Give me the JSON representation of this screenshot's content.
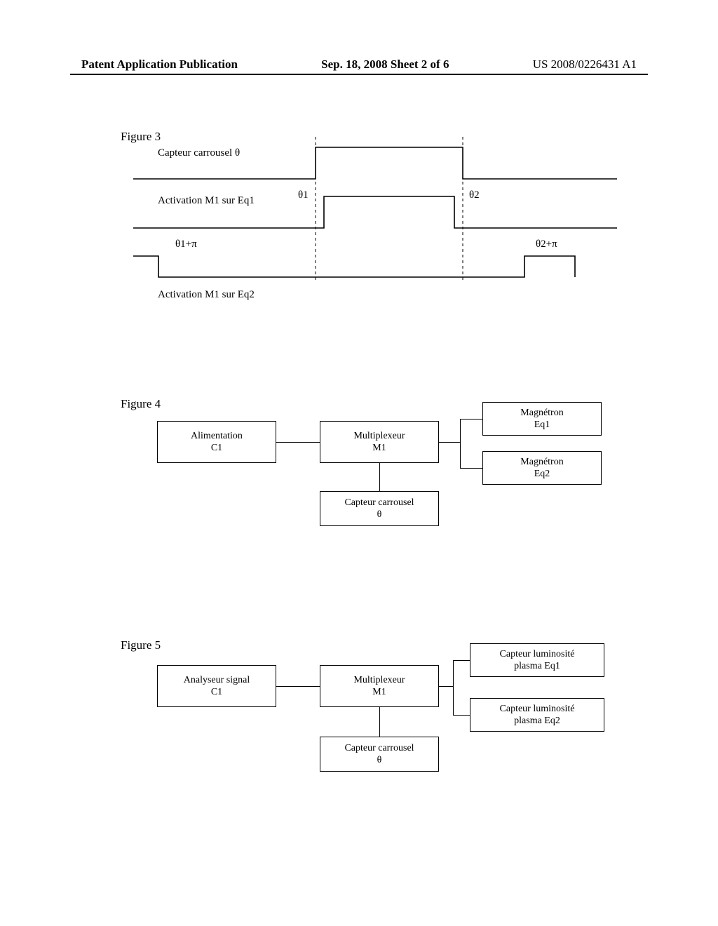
{
  "header": {
    "left": "Patent Application Publication",
    "center": "Sep. 18, 2008  Sheet 2 of 6",
    "right": "US 2008/0226431 A1"
  },
  "fig3": {
    "title": "Figure 3",
    "row1": "Capteur carrousel θ",
    "row2": "Activation M1 sur Eq1",
    "row3": "Activation M1 sur Eq2",
    "theta1": "θ1",
    "theta2": "θ2",
    "theta1pi": "θ1+π",
    "theta2pi": "θ2+π"
  },
  "fig4": {
    "title": "Figure 4",
    "c1_l1": "Alimentation",
    "c1_l2": "C1",
    "m1_l1": "Multiplexeur",
    "m1_l2": "M1",
    "eq1_l1": "Magnétron",
    "eq1_l2": "Eq1",
    "eq2_l1": "Magnétron",
    "eq2_l2": "Eq2",
    "th_l1": "Capteur carrousel",
    "th_l2": "θ"
  },
  "fig5": {
    "title": "Figure 5",
    "c1_l1": "Analyseur signal",
    "c1_l2": "C1",
    "m1_l1": "Multiplexeur",
    "m1_l2": "M1",
    "eq1_l1": "Capteur luminosité",
    "eq1_l2": "plasma Eq1",
    "eq2_l1": "Capteur luminosité",
    "eq2_l2": "plasma Eq2",
    "th_l1": "Capteur carrousel",
    "th_l2": "θ"
  }
}
